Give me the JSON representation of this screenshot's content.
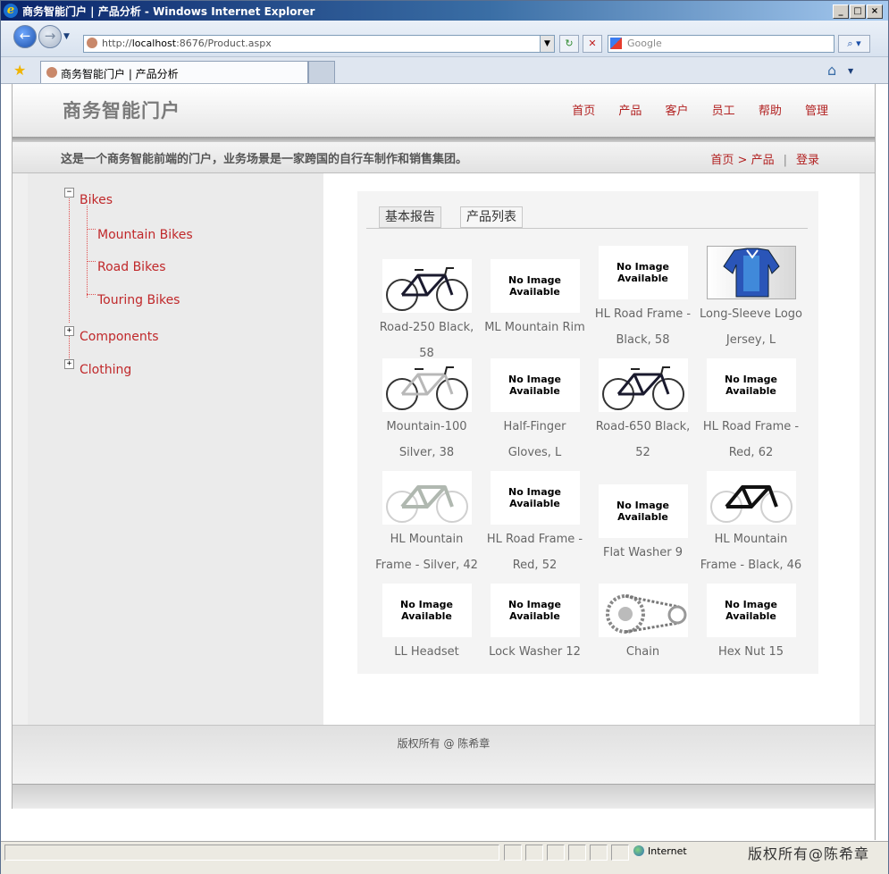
{
  "window": {
    "title": "商务智能门户 | 产品分析 - Windows Internet Explorer",
    "ie_glyph": "e"
  },
  "addressbar": {
    "url_prefix": "http://",
    "url_host": "localhost",
    "url_rest": ":8676/Product.aspx",
    "search_placeholder": "Google"
  },
  "tab": {
    "label": "商务智能门户 | 产品分析"
  },
  "site": {
    "logo": "商务智能门户",
    "nav": [
      "首页",
      "产品",
      "客户",
      "员工",
      "帮助",
      "管理"
    ],
    "tagline": "这是一个商务智能前端的门户，业务场景是一家跨国的自行车制作和销售集团。",
    "breadcrumb_home": "首页",
    "breadcrumb_sep": " > ",
    "breadcrumb_current": "产品",
    "pipe": "|",
    "login": "登录"
  },
  "tree": {
    "nodes": [
      {
        "label": "Bikes",
        "toggle": "−"
      },
      {
        "label": "Mountain Bikes"
      },
      {
        "label": "Road Bikes"
      },
      {
        "label": "Touring Bikes"
      },
      {
        "label": "Components",
        "toggle": "+"
      },
      {
        "label": "Clothing",
        "toggle": "+"
      }
    ]
  },
  "panel": {
    "tabs": [
      "基本报告",
      "产品列表"
    ],
    "no_image_line1": "No Image",
    "no_image_line2": "Available",
    "products": [
      {
        "name": "Road-250 Black, 58",
        "image": "road-bike-black"
      },
      {
        "name": "ML Mountain Rim",
        "image": "no-image"
      },
      {
        "name": "HL Road Frame - Black, 58",
        "image": "no-image"
      },
      {
        "name": "Long-Sleeve Logo Jersey, L",
        "image": "jersey"
      },
      {
        "name": "Mountain-100 Silver, 38",
        "image": "mountain-bike-silver"
      },
      {
        "name": "Half-Finger Gloves, L",
        "image": "no-image"
      },
      {
        "name": "Road-650 Black, 52",
        "image": "road-bike-black"
      },
      {
        "name": "HL Road Frame - Red, 62",
        "image": "no-image"
      },
      {
        "name": "HL Mountain Frame - Silver, 42",
        "image": "frame-silver"
      },
      {
        "name": "HL Road Frame - Red, 52",
        "image": "no-image"
      },
      {
        "name": "Flat Washer 9",
        "image": "no-image"
      },
      {
        "name": "HL Mountain Frame - Black, 46",
        "image": "frame-black"
      },
      {
        "name": "LL Headset",
        "image": "no-image"
      },
      {
        "name": "Lock Washer 12",
        "image": "no-image"
      },
      {
        "name": "Chain",
        "image": "chain"
      },
      {
        "name": "Hex Nut 15",
        "image": "no-image"
      }
    ]
  },
  "footer": {
    "copyright": "版权所有 @ 陈希章"
  },
  "statusbar": {
    "zone": "Internet",
    "watermark": "版权所有@陈希章"
  }
}
